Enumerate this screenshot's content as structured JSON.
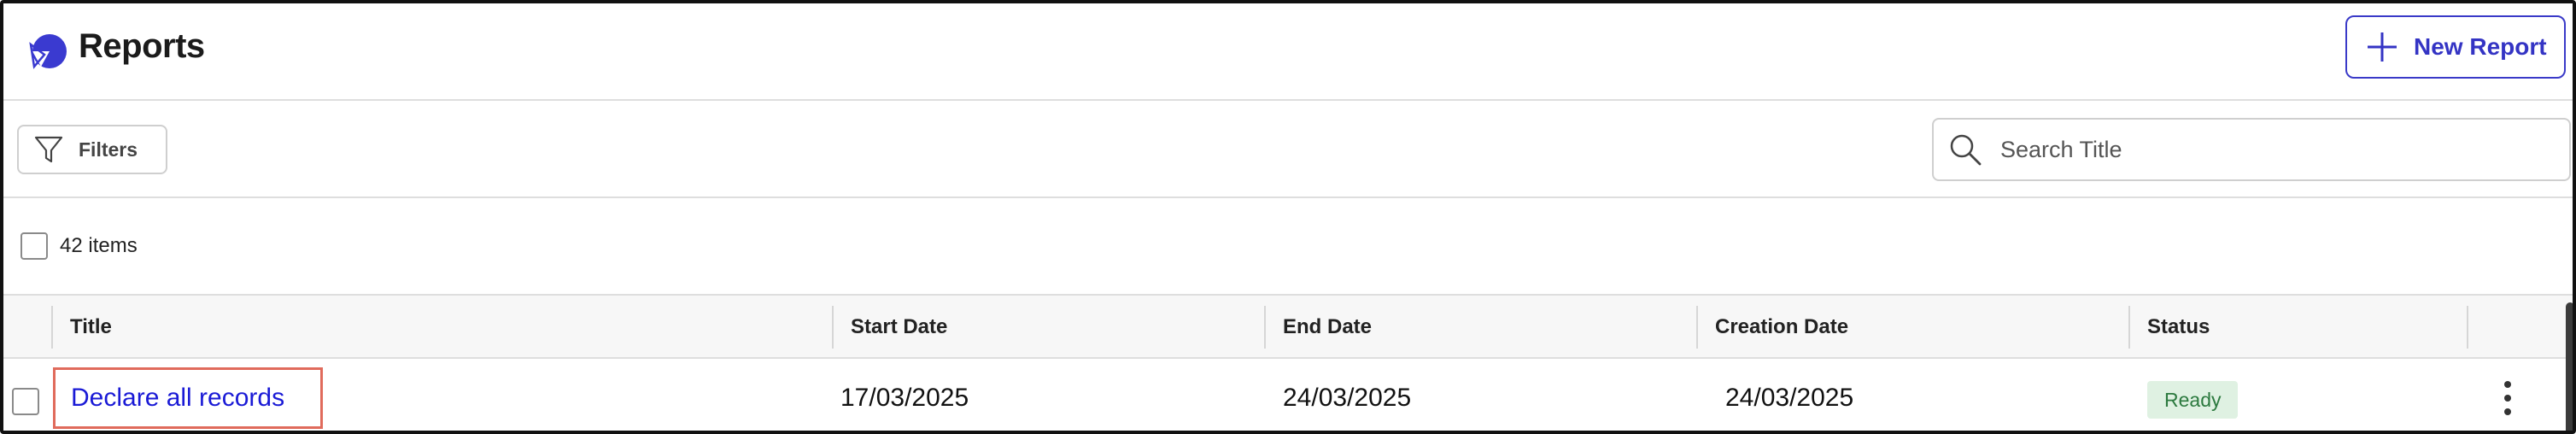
{
  "header": {
    "title": "Reports",
    "logo_icon": "pie-chart-icon",
    "new_report_label": "New Report",
    "new_report_icon": "plus-icon",
    "accent_color": "#3434c4"
  },
  "toolbar": {
    "filters_label": "Filters",
    "filters_icon": "filter-icon",
    "search_placeholder": "Search Title",
    "search_value": "",
    "search_icon": "search-icon"
  },
  "selection": {
    "items_count": "42 items"
  },
  "table": {
    "columns": [
      "Title",
      "Start Date",
      "End Date",
      "Creation Date",
      "Status"
    ],
    "rows": [
      {
        "title": "Declare all records",
        "start_date": "17/03/2025",
        "end_date": "24/03/2025",
        "creation_date": "24/03/2025",
        "status": "Ready",
        "status_color": "#2c7a3f",
        "actions_icon": "more-vertical-icon"
      }
    ]
  }
}
